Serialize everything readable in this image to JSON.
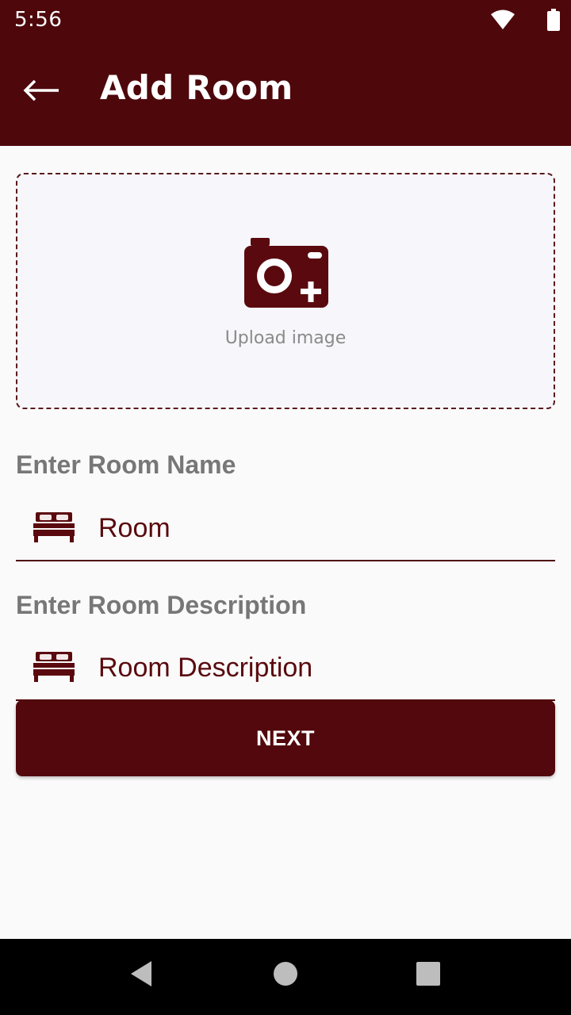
{
  "status_bar": {
    "time": "5:56",
    "icons": [
      "wifi-icon",
      "battery-icon"
    ]
  },
  "app_bar": {
    "back_icon": "arrow-left-icon",
    "title": "Add Room",
    "background_color": "#4e080b"
  },
  "upload": {
    "icon": "camera-plus-icon",
    "label": "Upload image"
  },
  "room_name": {
    "label": "Enter Room Name",
    "icon": "bed-icon",
    "placeholder": "Room",
    "value": ""
  },
  "room_description": {
    "label": "Enter Room Description",
    "icon": "bed-icon",
    "placeholder": "Room Description",
    "value": ""
  },
  "next_button": {
    "label": "NEXT",
    "color": "#52080c"
  },
  "nav_bar": {
    "buttons": [
      "back-triangle-icon",
      "home-circle-icon",
      "recents-square-icon"
    ]
  }
}
